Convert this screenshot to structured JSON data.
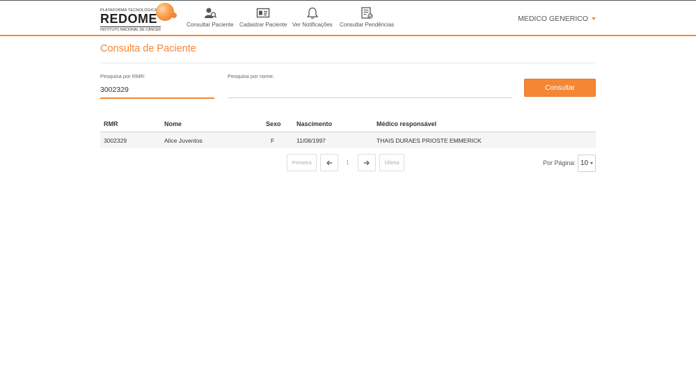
{
  "brand": {
    "line1": "PLATAFORMA TECNOLÓGICA",
    "name": "REDOME",
    "line3": "INSTITUTO NACIONAL DE CÂNCER"
  },
  "nav": {
    "items": [
      {
        "label": "Consultar Paciente",
        "icon": "search-user-icon"
      },
      {
        "label": "Cadastrar Paciente",
        "icon": "id-card-icon"
      },
      {
        "label": "Ver Notificações",
        "icon": "bell-icon"
      },
      {
        "label": "Consultar Pendências",
        "icon": "checklist-icon"
      }
    ],
    "user": "MEDICO GENERICO"
  },
  "page": {
    "title": "Consulta de Paciente"
  },
  "search": {
    "rmr_label": "Pesquisa por RMR:",
    "rmr_value": "3002329",
    "name_label": "Pesquisa por nome:",
    "name_value": "",
    "button": "Consultar"
  },
  "table": {
    "columns": [
      "RMR",
      "Nome",
      "Sexo",
      "Nascimento",
      "Médico responsável"
    ],
    "rows": [
      [
        "3002329",
        "Alice Juventos",
        "F",
        "11/08/1997",
        "THAIS DURAES PRIOSTE EMMERICK"
      ]
    ]
  },
  "pagination": {
    "first": "Primeira",
    "current": "1",
    "last": "Última",
    "per_page_label": "Por Página:",
    "per_page_value": "10"
  },
  "colors": {
    "accent": "#f58634"
  }
}
